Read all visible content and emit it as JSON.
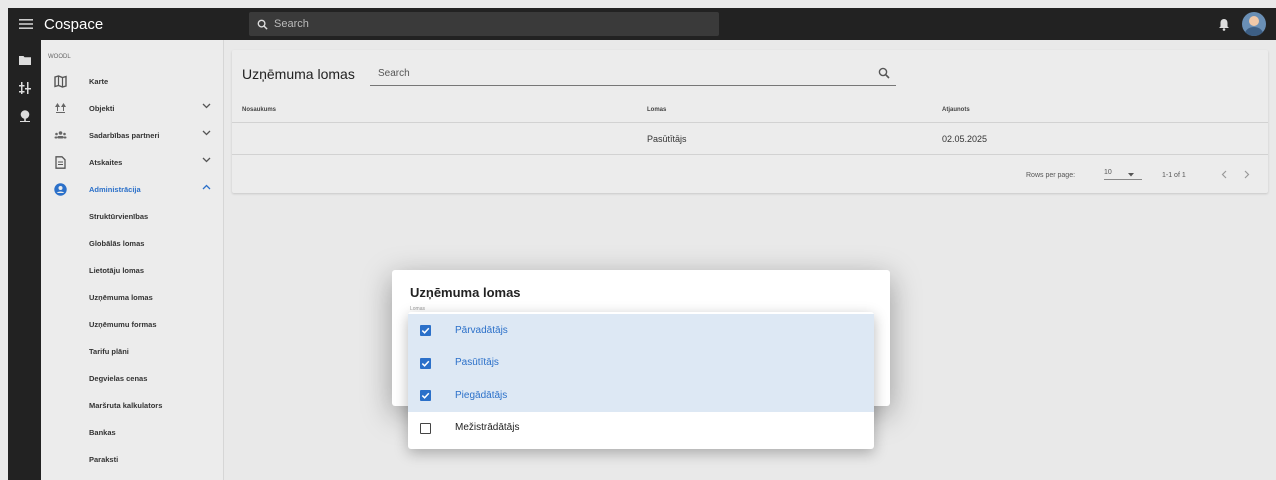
{
  "app": {
    "title": "Cospace",
    "search_placeholder": "Search"
  },
  "sidebar": {
    "org": "WOODL",
    "items": [
      {
        "label": "Karte",
        "icon": "map-icon",
        "expandable": false
      },
      {
        "label": "Objekti",
        "icon": "forest-icon",
        "expandable": true
      },
      {
        "label": "Sadarbības partneri",
        "icon": "partners-icon",
        "expandable": true
      },
      {
        "label": "Atskaites",
        "icon": "report-icon",
        "expandable": true
      },
      {
        "label": "Administrācija",
        "icon": "account-circle-icon",
        "expandable": true,
        "active": true
      }
    ],
    "subitems": [
      "Struktūrvienības",
      "Globālās lomas",
      "Lietotāju lomas",
      "Uzņēmuma lomas",
      "Uzņēmumu formas",
      "Tarifu plāni",
      "Degvielas cenas",
      "Maršruta kalkulators",
      "Bankas",
      "Paraksti"
    ]
  },
  "main": {
    "title": "Uzņēmuma lomas",
    "search_placeholder": "Search",
    "columns": [
      "Nosaukums",
      "Lomas",
      "Atjaunots"
    ],
    "rows": [
      {
        "name": "",
        "roles": "Pasūtītājs",
        "updated": "02.05.2025"
      }
    ],
    "pager": {
      "rows_label": "Rows per page:",
      "rows_value": "10",
      "range": "1-1 of 1"
    }
  },
  "dialog": {
    "title": "Uzņēmuma lomas",
    "field_label": "Lomas",
    "options": [
      {
        "label": "Pārvadātājs",
        "checked": true
      },
      {
        "label": "Pasūtītājs",
        "checked": true
      },
      {
        "label": "Piegādātājs",
        "checked": true
      },
      {
        "label": "Mežistrādātājs",
        "checked": false
      }
    ]
  },
  "colors": {
    "accent": "#2b70c9",
    "appbar": "#222222",
    "selected_bg": "#dde8f4"
  }
}
